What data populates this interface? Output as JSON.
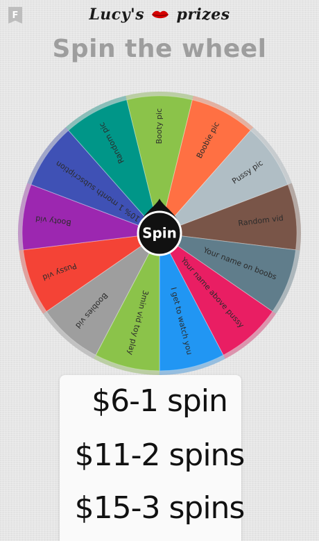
{
  "header": {
    "corner_icon_label": "F",
    "logo_left": "Lucy's",
    "logo_right": "prizes",
    "logo_icon": "lips-icon"
  },
  "title": "Spin the wheel",
  "wheel": {
    "center_label": "Spin",
    "segments": [
      {
        "label": "Booty pic",
        "color": "#8bc34a"
      },
      {
        "label": "Boobie pic",
        "color": "#ff7043"
      },
      {
        "label": "Pussy pic",
        "color": "#b0bec5"
      },
      {
        "label": "Random vid",
        "color": "#795548"
      },
      {
        "label": "Your name on boobs",
        "color": "#607d8b"
      },
      {
        "label": "Your name above pussy",
        "color": "#e91e63"
      },
      {
        "label": "I get to watch you",
        "color": "#2196f3"
      },
      {
        "label": "3min vid toy play",
        "color": "#8bc34a"
      },
      {
        "label": "Boobies vid",
        "color": "#9e9e9e"
      },
      {
        "label": "Pussy vid",
        "color": "#f44336"
      },
      {
        "label": "Booty vid",
        "color": "#9c27b0"
      },
      {
        "label": "10% 1 month subscription",
        "color": "#3f51b5"
      },
      {
        "label": "Random pic",
        "color": "#009688"
      }
    ]
  },
  "prices": {
    "line1": "$6-1 spin",
    "line2": "$11-2 spins",
    "line3": "$15-3 spins"
  }
}
